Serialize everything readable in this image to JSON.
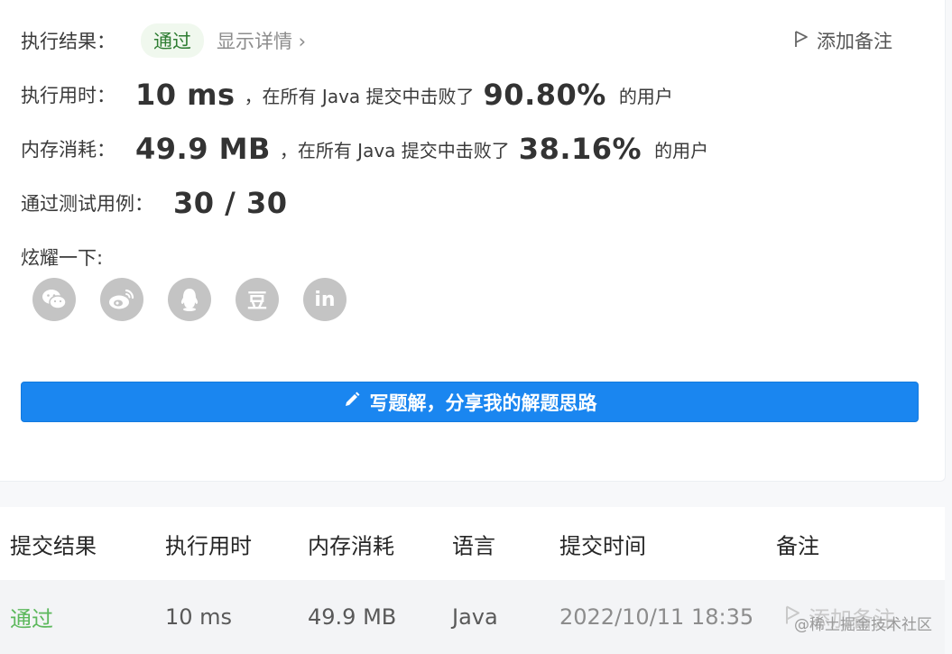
{
  "result": {
    "label": "执行结果：",
    "status": "通过",
    "details_link": "显示详情 ›",
    "add_note": "添加备注"
  },
  "runtime": {
    "label": "执行用时：",
    "value": "10 ms",
    "beat_text": "，在所有 Java 提交中击败了",
    "percent": "90.80%",
    "suffix": "的用户"
  },
  "memory": {
    "label": "内存消耗：",
    "value": "49.9 MB",
    "beat_text": "，在所有 Java 提交中击败了",
    "percent": "38.16%",
    "suffix": "的用户"
  },
  "tests": {
    "label": "通过测试用例：",
    "value": "30 / 30"
  },
  "share": {
    "label": "炫耀一下:",
    "icons": [
      "wechat-icon",
      "weibo-icon",
      "qq-icon",
      "douban-icon",
      "linkedin-icon"
    ],
    "douban_glyph": "豆",
    "linkedin_glyph": "in"
  },
  "write_button": "写题解，分享我的解题思路",
  "table": {
    "headers": [
      "提交结果",
      "执行用时",
      "内存消耗",
      "语言",
      "提交时间",
      "备注"
    ],
    "rows": [
      {
        "status": "通过",
        "runtime": "10 ms",
        "memory": "49.9 MB",
        "language": "Java",
        "time": "2022/10/11 18:35",
        "note": "添加备注"
      }
    ]
  },
  "watermark": "@稀土掘金技术社区",
  "colors": {
    "accent": "#1a86f0",
    "pass": "#5cb85c",
    "icon_gray": "#c4c4c4"
  }
}
